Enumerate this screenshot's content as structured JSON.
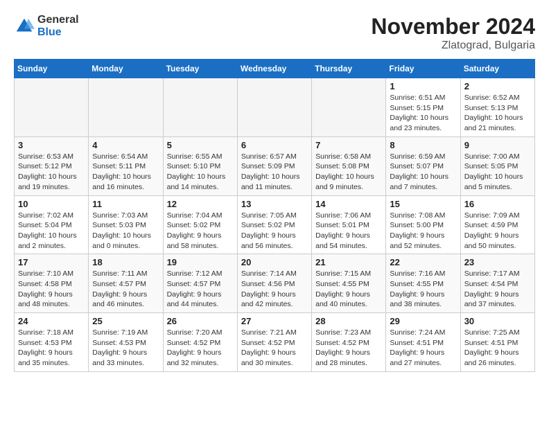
{
  "logo": {
    "general": "General",
    "blue": "Blue"
  },
  "title": "November 2024",
  "location": "Zlatograd, Bulgaria",
  "days_of_week": [
    "Sunday",
    "Monday",
    "Tuesday",
    "Wednesday",
    "Thursday",
    "Friday",
    "Saturday"
  ],
  "weeks": [
    [
      {
        "day": "",
        "info": ""
      },
      {
        "day": "",
        "info": ""
      },
      {
        "day": "",
        "info": ""
      },
      {
        "day": "",
        "info": ""
      },
      {
        "day": "",
        "info": ""
      },
      {
        "day": "1",
        "info": "Sunrise: 6:51 AM\nSunset: 5:15 PM\nDaylight: 10 hours and 23 minutes."
      },
      {
        "day": "2",
        "info": "Sunrise: 6:52 AM\nSunset: 5:13 PM\nDaylight: 10 hours and 21 minutes."
      }
    ],
    [
      {
        "day": "3",
        "info": "Sunrise: 6:53 AM\nSunset: 5:12 PM\nDaylight: 10 hours and 19 minutes."
      },
      {
        "day": "4",
        "info": "Sunrise: 6:54 AM\nSunset: 5:11 PM\nDaylight: 10 hours and 16 minutes."
      },
      {
        "day": "5",
        "info": "Sunrise: 6:55 AM\nSunset: 5:10 PM\nDaylight: 10 hours and 14 minutes."
      },
      {
        "day": "6",
        "info": "Sunrise: 6:57 AM\nSunset: 5:09 PM\nDaylight: 10 hours and 11 minutes."
      },
      {
        "day": "7",
        "info": "Sunrise: 6:58 AM\nSunset: 5:08 PM\nDaylight: 10 hours and 9 minutes."
      },
      {
        "day": "8",
        "info": "Sunrise: 6:59 AM\nSunset: 5:07 PM\nDaylight: 10 hours and 7 minutes."
      },
      {
        "day": "9",
        "info": "Sunrise: 7:00 AM\nSunset: 5:05 PM\nDaylight: 10 hours and 5 minutes."
      }
    ],
    [
      {
        "day": "10",
        "info": "Sunrise: 7:02 AM\nSunset: 5:04 PM\nDaylight: 10 hours and 2 minutes."
      },
      {
        "day": "11",
        "info": "Sunrise: 7:03 AM\nSunset: 5:03 PM\nDaylight: 10 hours and 0 minutes."
      },
      {
        "day": "12",
        "info": "Sunrise: 7:04 AM\nSunset: 5:02 PM\nDaylight: 9 hours and 58 minutes."
      },
      {
        "day": "13",
        "info": "Sunrise: 7:05 AM\nSunset: 5:02 PM\nDaylight: 9 hours and 56 minutes."
      },
      {
        "day": "14",
        "info": "Sunrise: 7:06 AM\nSunset: 5:01 PM\nDaylight: 9 hours and 54 minutes."
      },
      {
        "day": "15",
        "info": "Sunrise: 7:08 AM\nSunset: 5:00 PM\nDaylight: 9 hours and 52 minutes."
      },
      {
        "day": "16",
        "info": "Sunrise: 7:09 AM\nSunset: 4:59 PM\nDaylight: 9 hours and 50 minutes."
      }
    ],
    [
      {
        "day": "17",
        "info": "Sunrise: 7:10 AM\nSunset: 4:58 PM\nDaylight: 9 hours and 48 minutes."
      },
      {
        "day": "18",
        "info": "Sunrise: 7:11 AM\nSunset: 4:57 PM\nDaylight: 9 hours and 46 minutes."
      },
      {
        "day": "19",
        "info": "Sunrise: 7:12 AM\nSunset: 4:57 PM\nDaylight: 9 hours and 44 minutes."
      },
      {
        "day": "20",
        "info": "Sunrise: 7:14 AM\nSunset: 4:56 PM\nDaylight: 9 hours and 42 minutes."
      },
      {
        "day": "21",
        "info": "Sunrise: 7:15 AM\nSunset: 4:55 PM\nDaylight: 9 hours and 40 minutes."
      },
      {
        "day": "22",
        "info": "Sunrise: 7:16 AM\nSunset: 4:55 PM\nDaylight: 9 hours and 38 minutes."
      },
      {
        "day": "23",
        "info": "Sunrise: 7:17 AM\nSunset: 4:54 PM\nDaylight: 9 hours and 37 minutes."
      }
    ],
    [
      {
        "day": "24",
        "info": "Sunrise: 7:18 AM\nSunset: 4:53 PM\nDaylight: 9 hours and 35 minutes."
      },
      {
        "day": "25",
        "info": "Sunrise: 7:19 AM\nSunset: 4:53 PM\nDaylight: 9 hours and 33 minutes."
      },
      {
        "day": "26",
        "info": "Sunrise: 7:20 AM\nSunset: 4:52 PM\nDaylight: 9 hours and 32 minutes."
      },
      {
        "day": "27",
        "info": "Sunrise: 7:21 AM\nSunset: 4:52 PM\nDaylight: 9 hours and 30 minutes."
      },
      {
        "day": "28",
        "info": "Sunrise: 7:23 AM\nSunset: 4:52 PM\nDaylight: 9 hours and 28 minutes."
      },
      {
        "day": "29",
        "info": "Sunrise: 7:24 AM\nSunset: 4:51 PM\nDaylight: 9 hours and 27 minutes."
      },
      {
        "day": "30",
        "info": "Sunrise: 7:25 AM\nSunset: 4:51 PM\nDaylight: 9 hours and 26 minutes."
      }
    ]
  ]
}
